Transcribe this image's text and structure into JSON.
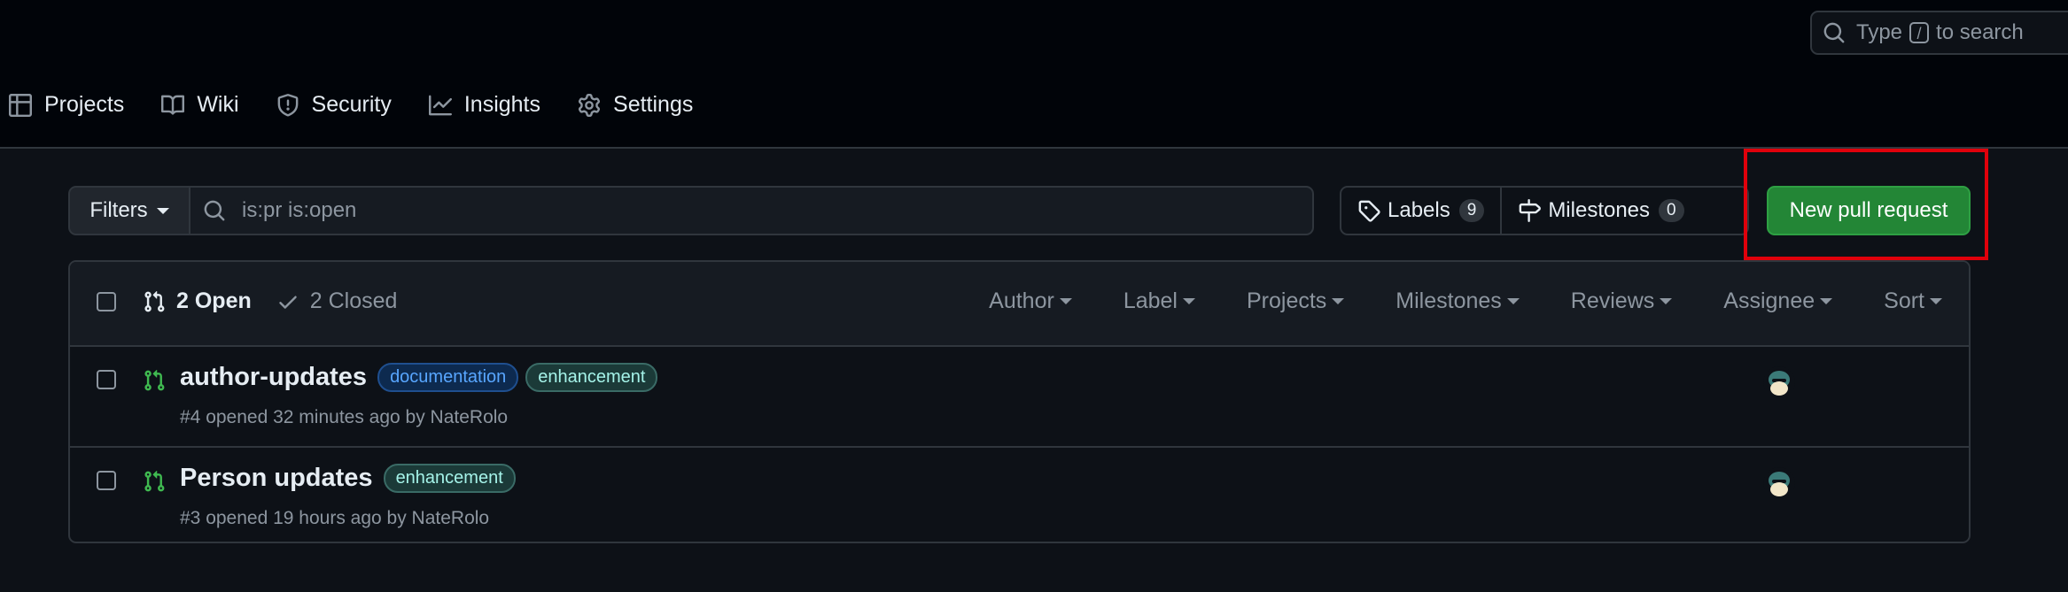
{
  "header": {
    "search": {
      "prefix": "Type",
      "kbd": "/",
      "suffix": "to search"
    },
    "nav": [
      {
        "label": "Projects",
        "icon": "table-icon"
      },
      {
        "label": "Wiki",
        "icon": "book-icon"
      },
      {
        "label": "Security",
        "icon": "shield-icon"
      },
      {
        "label": "Insights",
        "icon": "graph-icon"
      },
      {
        "label": "Settings",
        "icon": "gear-icon"
      }
    ]
  },
  "toolbar": {
    "filters_label": "Filters",
    "search_value": "is:pr is:open",
    "labels_label": "Labels",
    "labels_count": "9",
    "milestones_label": "Milestones",
    "milestones_count": "0",
    "new_pr_label": "New pull request"
  },
  "list_header": {
    "open_label": "2 Open",
    "closed_label": "2 Closed",
    "filters": [
      "Author",
      "Label",
      "Projects",
      "Milestones",
      "Reviews",
      "Assignee",
      "Sort"
    ]
  },
  "pull_requests": [
    {
      "title": "author-updates",
      "labels": [
        "documentation",
        "enhancement"
      ],
      "meta": "#4 opened 32 minutes ago by NateRolo"
    },
    {
      "title": "Person updates",
      "labels": [
        "enhancement"
      ],
      "meta": "#3 opened 19 hours ago by NateRolo"
    }
  ],
  "colors": {
    "accent_green": "#238636",
    "open_icon_green": "#3fb950",
    "highlight_red": "#e0000b",
    "label_documentation": "#58a6ff",
    "label_enhancement": "#a5f3e9"
  }
}
